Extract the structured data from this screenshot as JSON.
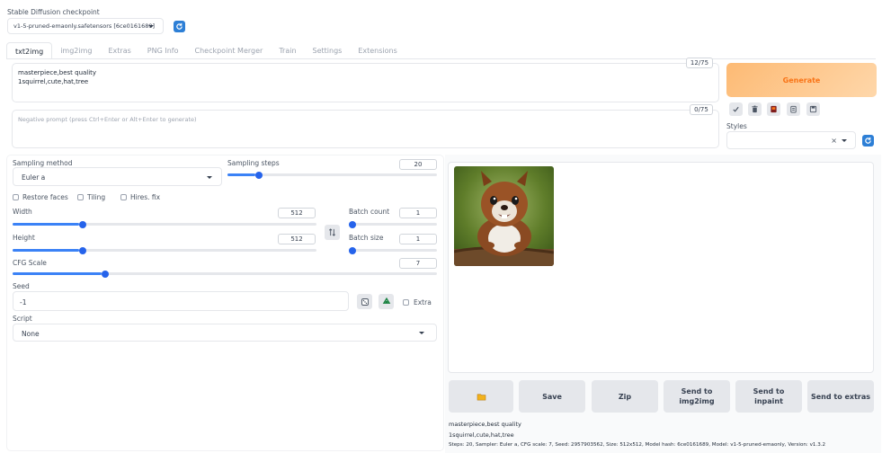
{
  "checkpoint": {
    "label": "Stable Diffusion checkpoint",
    "value": "v1-5-pruned-emaonly.safetensors [6ce0161689]"
  },
  "tabs": [
    {
      "label": "txt2img",
      "active": true
    },
    {
      "label": "img2img"
    },
    {
      "label": "Extras"
    },
    {
      "label": "PNG Info"
    },
    {
      "label": "Checkpoint Merger"
    },
    {
      "label": "Train"
    },
    {
      "label": "Settings"
    },
    {
      "label": "Extensions"
    }
  ],
  "prompt": {
    "line1": "masterpiece,best quality",
    "line2": "1squirrel,cute,hat,tree",
    "counter": "12/75"
  },
  "negative_prompt": {
    "placeholder": "Negative prompt (press Ctrl+Enter or Alt+Enter to generate)",
    "counter": "0/75"
  },
  "generate_label": "Generate",
  "styles_label": "Styles",
  "styles_clear": "×",
  "sampling": {
    "method_label": "Sampling method",
    "method_value": "Euler a",
    "steps_label": "Sampling steps",
    "steps_value": "20",
    "steps_fraction": 0.133
  },
  "checkboxes": {
    "restore_faces": "Restore faces",
    "tiling": "Tiling",
    "hires_fix": "Hires. fix"
  },
  "width": {
    "label": "Width",
    "value": "512",
    "fraction": 0.22
  },
  "height": {
    "label": "Height",
    "value": "512",
    "fraction": 0.22
  },
  "batch_count": {
    "label": "Batch count",
    "value": "1",
    "fraction": 0.0
  },
  "batch_size": {
    "label": "Batch size",
    "value": "1",
    "fraction": 0.0
  },
  "cfg": {
    "label": "CFG Scale",
    "value": "7",
    "fraction": 0.21
  },
  "seed": {
    "label": "Seed",
    "value": "-1",
    "extra_label": "Extra"
  },
  "script": {
    "label": "Script",
    "value": "None"
  },
  "output_buttons": {
    "save": "Save",
    "zip": "Zip",
    "send_img2img_1": "Send to",
    "send_img2img_2": "img2img",
    "send_inpaint_1": "Send to",
    "send_inpaint_2": "inpaint",
    "send_extras": "Send to extras"
  },
  "generation_info": {
    "line1": "masterpiece,best quality",
    "line2": "1squirrel,cute,hat,tree",
    "line3": "Steps: 20, Sampler: Euler a, CFG scale: 7, Seed: 2957903562, Size: 512x512, Model hash: 6ce0161689, Model: v1-5-pruned-emaonly, Version: v1.3.2"
  },
  "colors": {
    "accent": "#2d7fd6",
    "generate_gradient_start": "#fdba74",
    "generate_gradient_end": "#fed7aa",
    "slider": "#3b82f6"
  }
}
